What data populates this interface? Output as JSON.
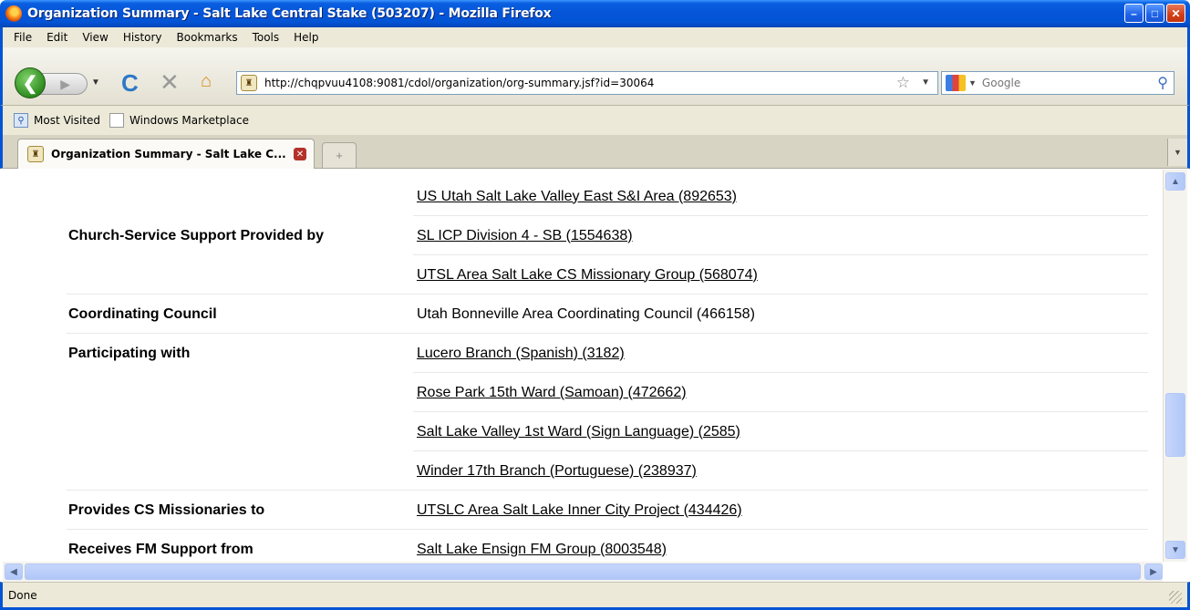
{
  "window": {
    "title": "Organization Summary - Salt Lake Central Stake (503207)  - Mozilla Firefox"
  },
  "menu": [
    "File",
    "Edit",
    "View",
    "History",
    "Bookmarks",
    "Tools",
    "Help"
  ],
  "toolbar": {
    "url": "http://chqpvuu4108:9081/cdol/organization/org-summary.jsf?id=30064",
    "search_placeholder": "Google"
  },
  "bookmarks": [
    "Most Visited",
    "Windows Marketplace"
  ],
  "tabs": [
    {
      "label": "Organization Summary - Salt Lake C..."
    }
  ],
  "rows": [
    {
      "label": "",
      "value": "US Utah Salt Lake Valley East S&I Area (892653) ",
      "link": true
    },
    {
      "label": "Church-Service Support Provided by",
      "value": "SL ICP Division 4 - SB (1554638) ",
      "link": true
    },
    {
      "label": "",
      "value": "UTSL Area Salt Lake CS Missionary Group (568074) ",
      "link": true
    },
    {
      "label": "Coordinating Council",
      "value": "Utah Bonneville Area Coordinating Council (466158)",
      "link": false
    },
    {
      "label": "Participating with",
      "value": "Lucero Branch (Spanish)  (3182) ",
      "link": true
    },
    {
      "label": "",
      "value": "Rose Park 15th Ward (Samoan) (472662) ",
      "link": true
    },
    {
      "label": "",
      "value": "Salt Lake Valley 1st Ward (Sign Language)  (2585) ",
      "link": true
    },
    {
      "label": "",
      "value": "Winder 17th Branch (Portuguese)  (238937) ",
      "link": true
    },
    {
      "label": "Provides CS Missionaries to",
      "value": "UTSLC Area Salt Lake Inner City Project (434426) ",
      "link": true
    },
    {
      "label": "Receives FM Support from",
      "value": "Salt Lake Ensign FM Group (8003548) ",
      "link": true
    }
  ],
  "status": {
    "text": "Done"
  }
}
